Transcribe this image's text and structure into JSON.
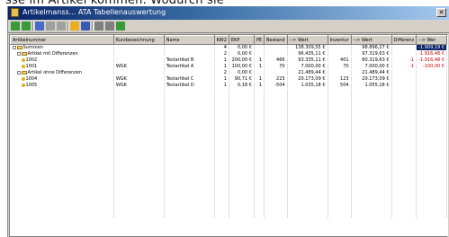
{
  "caption": {
    "text": "sse im Artikel kommen. Wodurch sie"
  },
  "window": {
    "title": "Artikelmanss... ATA  Tabellenauswertung",
    "close_glyph": "✕"
  },
  "toolbar": {
    "buttons": [
      {
        "name": "back-icon",
        "color": "#3a9a3a"
      },
      {
        "name": "forward-icon",
        "color": "#3a9a3a"
      },
      {
        "name": "grid-icon",
        "color": "#4a6ac8"
      },
      {
        "name": "list-icon",
        "color": "#a0a0a0"
      },
      {
        "name": "table-icon",
        "color": "#a0a0a0"
      },
      {
        "name": "folder-icon",
        "color": "#e8b020"
      },
      {
        "name": "save-icon",
        "color": "#3a5ab8"
      },
      {
        "name": "print-icon",
        "color": "#808080"
      },
      {
        "name": "preview-icon",
        "color": "#808080"
      },
      {
        "name": "export-icon",
        "color": "#3a9a3a"
      }
    ]
  },
  "grid": {
    "columns": [
      "Artikelnummer",
      "Kurzbezeichnung",
      "Name",
      "KW2",
      "EKP",
      "PE",
      "Bestand",
      "--> Wert",
      "Inventur",
      "--> Wert",
      "Differenz",
      "--> Wer"
    ],
    "rows": [
      {
        "level": 0,
        "type": "group",
        "cells": [
          "Summen",
          "",
          "",
          "4",
          "0,00 €",
          "",
          "",
          "138.309,55 €",
          "",
          "98.896,27 €",
          "",
          "-1.909,19 €"
        ]
      },
      {
        "level": 1,
        "type": "group",
        "cells": [
          "Artikel mit Differenzen",
          "",
          "",
          "2",
          "0,00 €",
          "",
          "",
          "96.435,11 €",
          "",
          "97.319,63 €",
          "",
          "-1.916,48 €"
        ]
      },
      {
        "level": 2,
        "type": "item",
        "cells": [
          "1002",
          "",
          "Testartikel B",
          "1",
          "200,00 €",
          "1",
          "466",
          "93.335,11 €",
          "401",
          "80.319,63 €",
          "-1",
          "-1.916,48 €"
        ]
      },
      {
        "level": 2,
        "type": "item",
        "cells": [
          "1001",
          "WGK",
          "Testartikel A",
          "1",
          "100,00 €",
          "1",
          "70",
          "7.000,00 €",
          "70",
          "7.000,00 €",
          "-1",
          "-100,00 €"
        ]
      },
      {
        "level": 1,
        "type": "group",
        "cells": [
          "Artikel ohne Differenzen",
          "",
          "",
          "2",
          "0,00 €",
          "",
          "",
          "21.489,44 €",
          "",
          "21.489,44 €",
          "",
          ""
        ]
      },
      {
        "level": 2,
        "type": "item",
        "cells": [
          "1004",
          "WGK",
          "Testartikel C",
          "1",
          "90,71 €",
          "1",
          "223",
          "20.173,09 €",
          "123",
          "20.173,09 €",
          "",
          ""
        ]
      },
      {
        "level": 2,
        "type": "item",
        "cells": [
          "1005",
          "WGK",
          "Testartikel D",
          "1",
          "0,18 €",
          "1",
          "-504",
          "1.035,18 €",
          "504",
          "1.055,18 €",
          "",
          ""
        ]
      }
    ]
  }
}
